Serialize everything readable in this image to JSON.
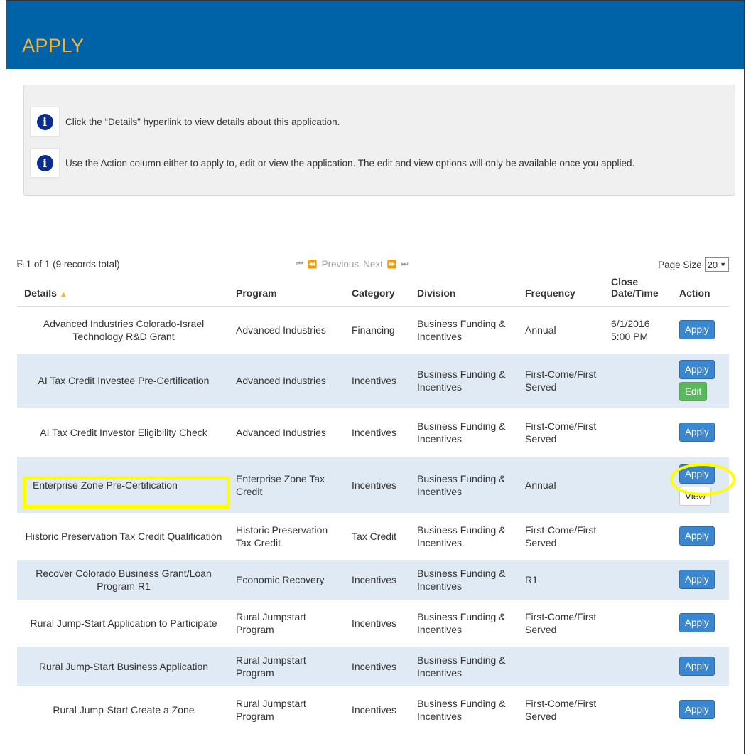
{
  "page": {
    "title": "APPLY"
  },
  "info": [
    {
      "icon": "info-icon",
      "text": "Click the “Details” hyperlink to view details about this application."
    },
    {
      "icon": "info-icon",
      "text": "Use the Action column either to apply to, edit or view the application. The edit and view options will only be available once you applied."
    }
  ],
  "pager": {
    "summary": "1 of 1 (9 records total)",
    "first_glyph": "⏮",
    "prev_glyph": "⏪",
    "previous_label": "Previous",
    "next_label": "Next",
    "next_glyph": "⏩",
    "last_glyph": "⏭",
    "page_size_label": "Page Size",
    "page_size_value": "20"
  },
  "table": {
    "columns": {
      "details": "Details",
      "program": "Program",
      "category": "Category",
      "division": "Division",
      "frequency": "Frequency",
      "close": "Close Date/Time",
      "action": "Action"
    },
    "rows": [
      {
        "details": "Advanced Industries Colorado-Israel Technology R&D Grant",
        "program": "Advanced Industries",
        "category": "Financing",
        "division": "Business Funding & Incentives",
        "frequency": "Annual",
        "close": "6/1/2016 5:00 PM",
        "actions": [
          "Apply"
        ]
      },
      {
        "details": "AI Tax Credit Investee Pre-Certification",
        "program": "Advanced Industries",
        "category": "Incentives",
        "division": "Business Funding & Incentives",
        "frequency": "First-Come/First Served",
        "close": "",
        "actions": [
          "Apply",
          "Edit"
        ]
      },
      {
        "details": "AI Tax Credit Investor Eligibility Check",
        "program": "Advanced Industries",
        "category": "Incentives",
        "division": "Business Funding & Incentives",
        "frequency": "First-Come/First Served",
        "close": "",
        "actions": [
          "Apply"
        ]
      },
      {
        "details": "Enterprise Zone Pre-Certification",
        "program": "Enterprise Zone Tax Credit",
        "category": "Incentives",
        "division": "Business Funding & Incentives",
        "frequency": "Annual",
        "close": "",
        "actions": [
          "Apply",
          "View"
        ]
      },
      {
        "details": "Historic Preservation Tax Credit Qualification",
        "program": "Historic Preservation Tax Credit",
        "category": "Tax Credit",
        "division": "Business Funding & Incentives",
        "frequency": "First-Come/First Served",
        "close": "",
        "actions": [
          "Apply"
        ]
      },
      {
        "details": "Recover Colorado Business Grant/Loan Program R1",
        "program": "Economic Recovery",
        "category": "Incentives",
        "division": "Business Funding & Incentives",
        "frequency": "R1",
        "close": "",
        "actions": [
          "Apply"
        ]
      },
      {
        "details": "Rural Jump-Start Application to Participate",
        "program": "Rural Jumpstart Program",
        "category": "Incentives",
        "division": "Business Funding & Incentives",
        "frequency": "First-Come/First Served",
        "close": "",
        "actions": [
          "Apply"
        ]
      },
      {
        "details": "Rural Jump-Start Business Application",
        "program": "Rural Jumpstart Program",
        "category": "Incentives",
        "division": "Business Funding & Incentives",
        "frequency": "",
        "close": "",
        "actions": [
          "Apply"
        ]
      },
      {
        "details": "Rural Jump-Start Create a Zone",
        "program": "Rural Jumpstart Program",
        "category": "Incentives",
        "division": "Business Funding & Incentives",
        "frequency": "First-Come/First Served",
        "close": "",
        "actions": [
          "Apply"
        ]
      }
    ]
  },
  "colors": {
    "header_bg": "#0063a8",
    "title": "#f5b335",
    "link": "#337ab7",
    "alt_row": "#dfeaf5",
    "apply_btn": "#3a87d1",
    "edit_btn": "#5cb85c",
    "highlight": "#ffff00"
  }
}
